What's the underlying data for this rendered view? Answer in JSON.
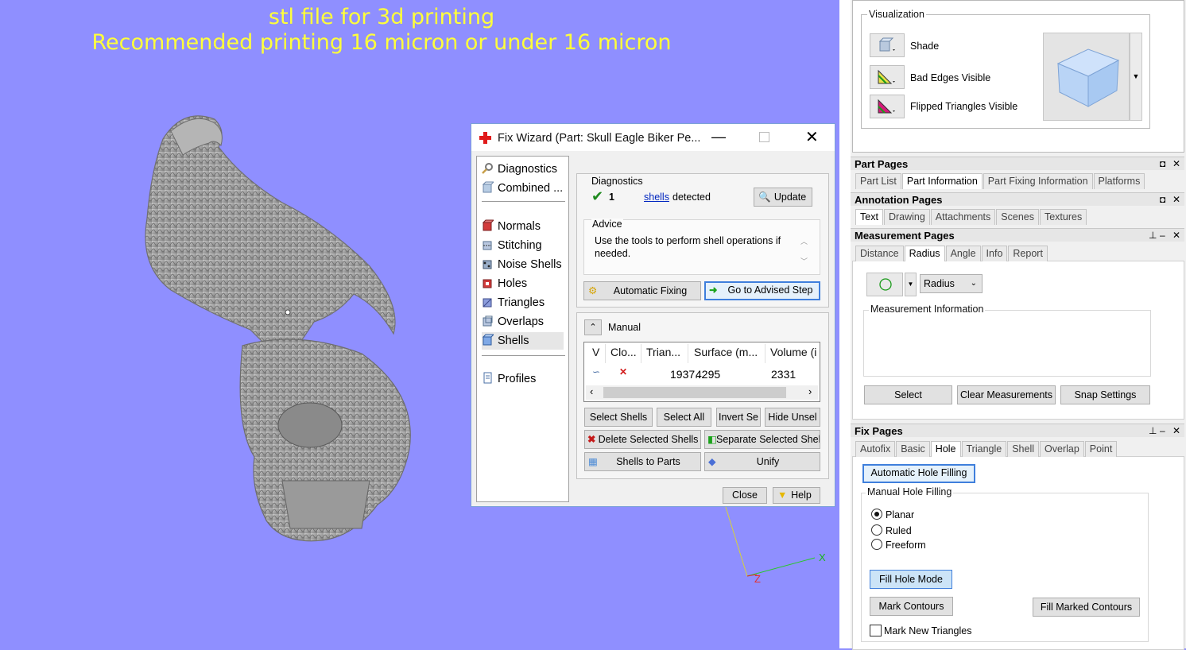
{
  "viewport": {
    "overlay_line1": "stl file for 3d printing",
    "overlay_line2": "Recommended printing 16 micron or under 16 micron",
    "axis_x": "X",
    "axis_z": "Z",
    "background_color": "#8f8fff",
    "overlay_text_color": "#ffff3a"
  },
  "dialog": {
    "title": "Fix Wizard (Part: Skull Eagle Biker Pe...",
    "sidebar": {
      "items": [
        {
          "label": "Diagnostics",
          "icon": "magnifier-icon"
        },
        {
          "label": "Combined ...",
          "icon": "cube-icon"
        },
        {
          "label": "Normals",
          "icon": "normals-cube-icon"
        },
        {
          "label": "Stitching",
          "icon": "stitching-icon"
        },
        {
          "label": "Noise Shells",
          "icon": "noise-shells-icon"
        },
        {
          "label": "Holes",
          "icon": "holes-icon"
        },
        {
          "label": "Triangles",
          "icon": "triangles-icon"
        },
        {
          "label": "Overlaps",
          "icon": "overlaps-icon"
        },
        {
          "label": "Shells",
          "icon": "shells-icon"
        },
        {
          "label": "Profiles",
          "icon": "document-icon"
        }
      ]
    },
    "diagnostics": {
      "group_label": "Diagnostics",
      "count": "1",
      "link_text": "shells",
      "suffix": "detected",
      "update_label": "Update"
    },
    "advice": {
      "group_label": "Advice",
      "text": "Use the tools to perform shell operations if needed."
    },
    "automatic_fixing_label": "Automatic Fixing",
    "go_advised_label": "Go to Advised Step",
    "manual": {
      "label": "Manual",
      "columns": [
        "V",
        "Clo...",
        "Trian...",
        "Surface (m...",
        "Volume (i"
      ],
      "row": {
        "triangles": "1937...",
        "surface": "4295",
        "volume": "2331"
      }
    },
    "buttons": {
      "select_shells": "Select Shells",
      "select_all": "Select All",
      "invert_selection": "Invert Se",
      "hide_unselected": "Hide Unsel",
      "delete_selected": "Delete Selected Shells",
      "separate_selected": "Separate Selected Shell",
      "shells_to_parts": "Shells to Parts",
      "unify": "Unify",
      "close": "Close",
      "help": "Help"
    }
  },
  "visualization": {
    "group_label": "Visualization",
    "shade_label": "Shade",
    "bad_edges_label": "Bad Edges Visible",
    "flipped_label": "Flipped Triangles Visible"
  },
  "part_pages": {
    "title": "Part Pages",
    "tabs": [
      "Part List",
      "Part Information",
      "Part Fixing Information",
      "Platforms"
    ]
  },
  "annotation_pages": {
    "title": "Annotation Pages",
    "tabs": [
      "Text",
      "Drawing",
      "Attachments",
      "Scenes",
      "Textures"
    ]
  },
  "measurement_pages": {
    "title": "Measurement Pages",
    "tabs": [
      "Distance",
      "Radius",
      "Angle",
      "Info",
      "Report"
    ],
    "mode_selected": "Radius",
    "info_label": "Measurement Information",
    "select_label": "Select",
    "clear_label": "Clear Measurements",
    "snap_label": "Snap Settings"
  },
  "fix_pages": {
    "title": "Fix Pages",
    "tabs": [
      "Autofix",
      "Basic",
      "Hole",
      "Triangle",
      "Shell",
      "Overlap",
      "Point"
    ],
    "auto_hole_label": "Automatic Hole Filling",
    "manual_group_label": "Manual Hole Filling",
    "radio_planar": "Planar",
    "radio_ruled": "Ruled",
    "radio_freeform": "Freeform",
    "fill_hole_mode_label": "Fill Hole Mode",
    "mark_contours_label": "Mark Contours",
    "fill_marked_label": "Fill Marked Contours",
    "mark_new_triangles_label": "Mark New Triangles"
  }
}
